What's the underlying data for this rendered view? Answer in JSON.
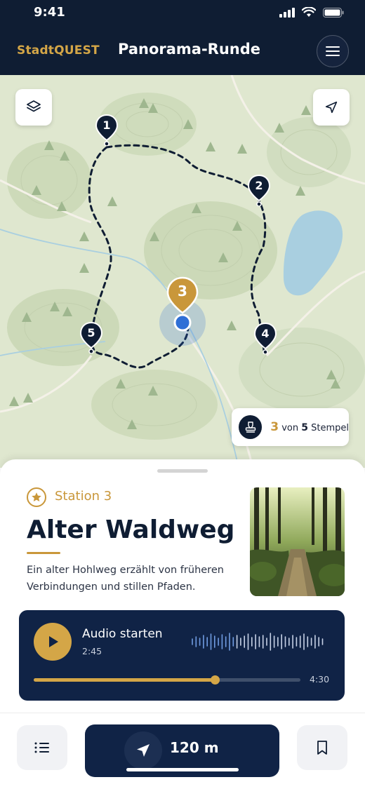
{
  "status_bar": {
    "time": "9:41"
  },
  "header": {
    "brand": "StadtQUEST",
    "title": "Panorama-Runde",
    "menu_icon": "hamburger-menu-icon"
  },
  "map": {
    "layers_icon": "layers-icon",
    "locate_icon": "navigation-arrow-icon",
    "stations": [
      {
        "number": "1",
        "state": "visited"
      },
      {
        "number": "2",
        "state": "visited"
      },
      {
        "number": "3",
        "state": "active"
      },
      {
        "number": "4",
        "state": "visited"
      },
      {
        "number": "5",
        "state": "visited"
      }
    ],
    "stamps": {
      "collected": "3",
      "connector": "von",
      "total": "5",
      "label": "Stempel"
    }
  },
  "station": {
    "label": "Station 3",
    "title": "Alter Waldweg",
    "description": "Ein alter Hohlweg erzählt von früheren Verbindungen und stillen Pfaden."
  },
  "audio": {
    "title": "Audio starten",
    "elapsed": "2:45",
    "total": "4:30",
    "progress": 0.68
  },
  "navigation": {
    "distance": "120 m"
  },
  "colors": {
    "navy": "#0f1d33",
    "gold": "#c9973a",
    "map_green": "#dfe7cf",
    "water": "#a9cfe0",
    "location_blue": "#2f6fd6"
  }
}
